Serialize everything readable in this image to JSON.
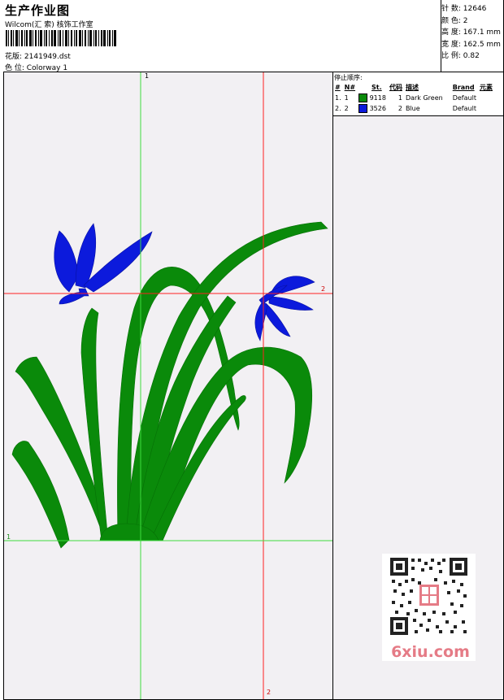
{
  "header": {
    "title": "生产作业图",
    "studio": "Wilcom(汇 索) 核饰工作室",
    "design_label": "花版:",
    "design_value": "2141949.dst",
    "colorway_label": "色 位:",
    "colorway_value": "Colorway 1"
  },
  "stats": [
    {
      "label": "针 数:",
      "value": "12646"
    },
    {
      "label": "颜 色:",
      "value": "2"
    },
    {
      "label": "高 度:",
      "value": "167.1 mm"
    },
    {
      "label": "宽 度:",
      "value": "162.5 mm"
    },
    {
      "label": "比 例:",
      "value": "0.82"
    }
  ],
  "guides": {
    "v1": "1",
    "v2": "2",
    "h1": "1",
    "h2": "2"
  },
  "stop_sequence": {
    "title": "停止顺序:",
    "columns": [
      "#",
      "N#",
      "St.",
      "代码",
      "描述",
      "Brand",
      "元素"
    ],
    "rows": [
      {
        "num": "1.",
        "n": "1",
        "color": "#0a8a0a",
        "st": "9118",
        "code": "1",
        "desc": "Dark Green",
        "brand": "Default",
        "elem": ""
      },
      {
        "num": "2.",
        "n": "2",
        "color": "#0c1adc",
        "st": "3526",
        "code": "2",
        "desc": "Blue",
        "brand": "Default",
        "elem": ""
      }
    ]
  },
  "colors": {
    "green": "#0a8a0a",
    "blue": "#0c1adc",
    "guide_green": "#3ddc3d",
    "guide_red": "#ff2020",
    "watermark": "#e57b86"
  },
  "watermark": {
    "text": "6xiu.com",
    "icon": "qr-code-icon"
  }
}
